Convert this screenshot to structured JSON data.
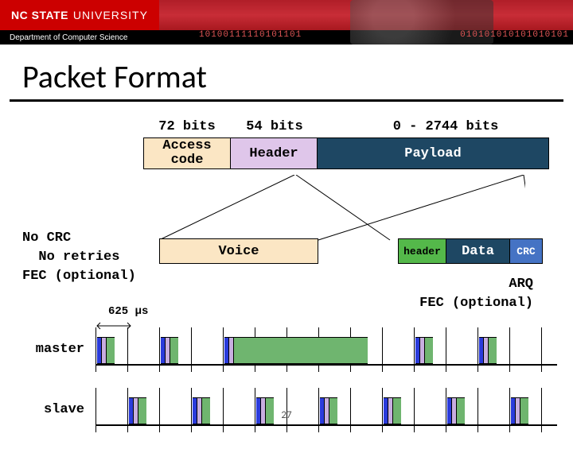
{
  "brand": {
    "name_bold": "NC STATE",
    "name_thin": "UNIVERSITY",
    "dept": "Department of Computer Science"
  },
  "decoration": {
    "binary_left": "10100111110101101",
    "binary_right": "010101010101010101"
  },
  "title": "Packet Format",
  "bits": {
    "access": "72 bits",
    "header": "54 bits",
    "payload": "0 - 2744 bits"
  },
  "fields": {
    "access_code": "Access\ncode",
    "header": "Header",
    "payload": "Payload"
  },
  "voice": {
    "label": "Voice",
    "notes": "No CRC\n  No retries\nFEC (optional)"
  },
  "data": {
    "header": "header",
    "data": "Data",
    "crc": "CRC",
    "notes": "ARQ\nFEC (optional)"
  },
  "timing": {
    "slot": "625 µs",
    "master": "master",
    "slave": "slave"
  },
  "page": "27"
}
